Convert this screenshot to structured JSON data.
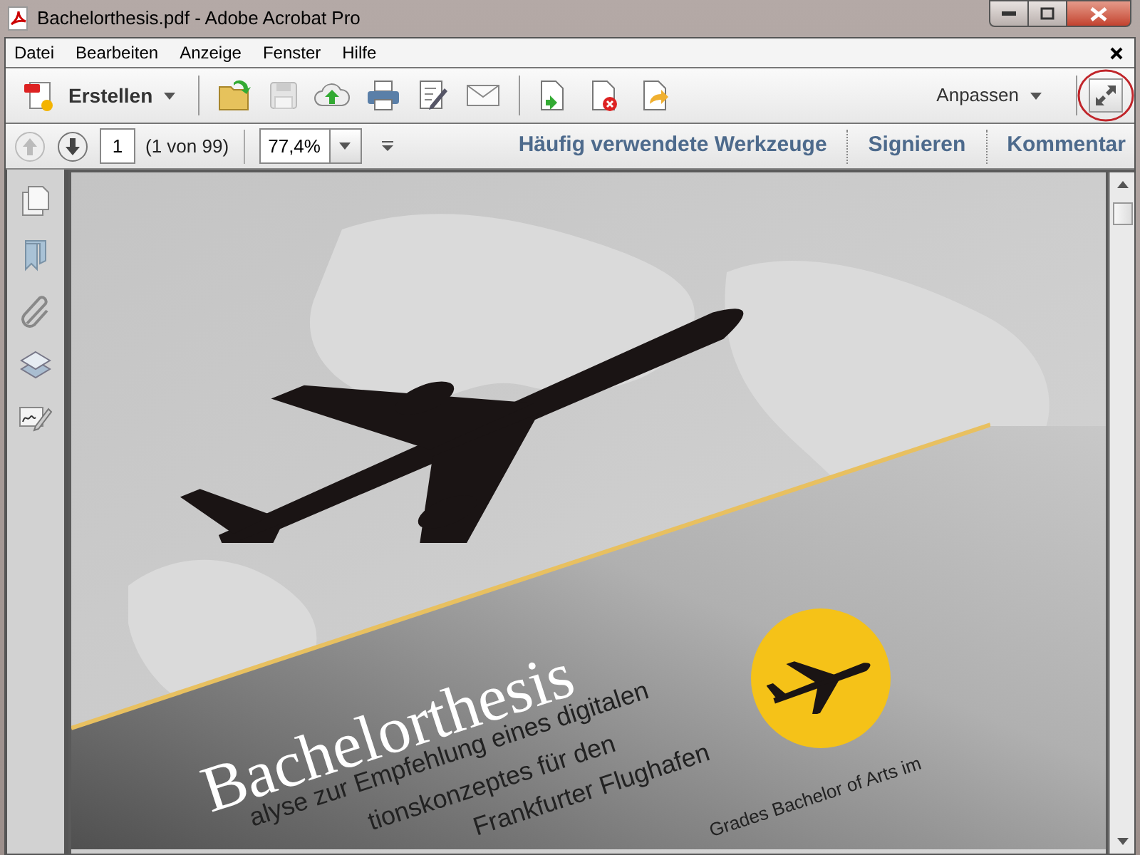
{
  "window": {
    "title": "Bachelorthesis.pdf - Adobe Acrobat Pro"
  },
  "menu": [
    "Datei",
    "Bearbeiten",
    "Anzeige",
    "Fenster",
    "Hilfe"
  ],
  "toolbar": {
    "create_button": "Erstellen",
    "customize_button": "Anpassen"
  },
  "navigation": {
    "page": "1",
    "page_count": "(1 von 99)",
    "zoom": "77,4%",
    "panels": [
      {
        "label": "Häufig verwendete Werkzeuge"
      },
      {
        "label": "Signieren"
      },
      {
        "label": "Kommentar"
      }
    ]
  },
  "document": {
    "title": "Bachelorthesis",
    "subtitle_lines": [
      "alyse zur Empfehlung eines digitalen",
      "tionskonzeptes für den",
      "Frankfurter Flughafen"
    ],
    "degree_line": "Grades Bachelor of Arts im"
  }
}
